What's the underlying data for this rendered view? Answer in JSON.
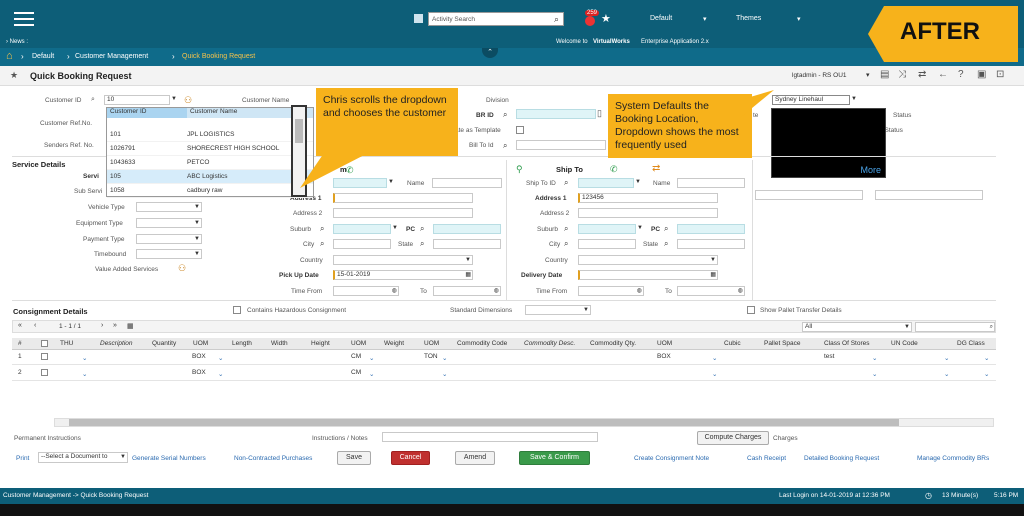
{
  "topbar": {
    "search_placeholder": "Activity Search",
    "notif_count": "259",
    "default_label": "Default",
    "themes_label": "Themes",
    "after_label": "AFTER"
  },
  "news": {
    "label": "› News :",
    "welcome": "Welcome to",
    "app_name": "VirtualWorks",
    "app_rest": "Enterprise Application 2.x"
  },
  "breadcrumb": {
    "items": [
      "Default",
      "Customer Management",
      "Quick Booking Request"
    ]
  },
  "page": {
    "title": "Quick Booking Request",
    "user": "lgtadmin - RS OU1"
  },
  "form": {
    "customer_id_label": "Customer ID",
    "customer_id_value": "10",
    "customer_name_label": "Customer Name",
    "customer_ref_label": "Customer Ref.No.",
    "senders_ref_label": "Senders Ref. No.",
    "division_label": "Division",
    "br_id_label": "BR ID",
    "as_template_label": "ate as Template",
    "bill_to_label": "Bill To Id",
    "booking_loc_value": "Sydney Linehaul",
    "booking_loc_label": "de",
    "status_label": "Status",
    "status2_label": "w Status",
    "more_label": "More",
    "t_label": "te"
  },
  "dropdown": {
    "col1": "Customer ID",
    "col2": "Customer Name",
    "rows": [
      {
        "id": "101",
        "name": "JPL LOGISTICS"
      },
      {
        "id": "1026791",
        "name": "SHORECREST HIGH SCHOOL"
      },
      {
        "id": "1043633",
        "name": "PETCO"
      },
      {
        "id": "105",
        "name": "ABC Logistics"
      },
      {
        "id": "1058",
        "name": "cadbury raw"
      }
    ]
  },
  "callouts": {
    "left": "Chris scrolls the dropdown and chooses the customer",
    "right": "System Defaults the Booking Location, Dropdown shows the most frequently used"
  },
  "service": {
    "title": "Service Details",
    "service_label": "Servi",
    "sub_label": "Sub Servi",
    "vehicle_label": "Vehicle Type",
    "equipment_label": "Equipment Type",
    "payment_label": "Payment Type",
    "timebound_label": "Timebound",
    "vas_label": "Value Added Services"
  },
  "shipfrom": {
    "title": "m",
    "name_label": "Name",
    "addr1_label": "Address 1",
    "addr2_label": "Address 2",
    "suburb_label": "Suburb",
    "pc_label": "PC",
    "city_label": "City",
    "state_label": "State",
    "country_label": "Country",
    "pickup_label": "Pick Up Date",
    "pickup_value": "15-01-2019",
    "timefrom_label": "Time From",
    "to_label": "To"
  },
  "shipto": {
    "title": "Ship To",
    "shipto_id_label": "Ship To ID",
    "name_label": "Name",
    "addr1_label": "Address 1",
    "addr1_value": "123456",
    "addr2_label": "Address 2",
    "suburb_label": "Suburb",
    "pc_label": "PC",
    "city_label": "City",
    "state_label": "State",
    "country_label": "Country",
    "delivery_label": "Delivery Date",
    "timefrom_label": "Time From",
    "to_label": "To"
  },
  "consignment": {
    "title": "Consignment Details",
    "hazard_label": "Contains Hazardous Consignment",
    "std_dim_label": "Standard Dimensions",
    "pallet_label": "Show Pallet Transfer Details",
    "pager": "1 - 1 / 1",
    "filter_value": "All"
  },
  "grid": {
    "columns": [
      "#",
      "THU",
      "Description",
      "Quantity",
      "UOM",
      "Length",
      "Width",
      "Height",
      "UOM",
      "Weight",
      "UOM",
      "Commodity Code",
      "Commodity Desc.",
      "Commodity Qty.",
      "UOM",
      "Cubic",
      "Pallet Space",
      "Class Of Stores",
      "UN Code",
      "DG Class"
    ],
    "rows": [
      {
        "n": "1",
        "uom1": "BOX",
        "uom2": "CM",
        "uom3": "TON",
        "uom4": "BOX",
        "stores": "test"
      },
      {
        "n": "2",
        "uom1": "BOX",
        "uom2": "CM",
        "uom3": "",
        "uom4": "",
        "stores": ""
      }
    ]
  },
  "footer": {
    "perm_label": "Permanent Instructions",
    "instr_label": "Instructions / Notes",
    "compute_label": "Compute Charges",
    "charges_label": "Charges",
    "print_label": "Print",
    "select_doc": "--Select a Document to",
    "gen_serial": "Generate Serial Numbers",
    "non_contracted": "Non-Contracted Purchases",
    "save": "Save",
    "cancel": "Cancel",
    "amend": "Amend",
    "save_confirm": "Save & Confirm",
    "create_note": "Create Consignment Note",
    "cash_receipt": "Cash Receipt",
    "detailed": "Detailed Booking Request",
    "manage_brs": "Manage Commodity BRs"
  },
  "status": {
    "path": "Customer Management -> Quick Booking Request",
    "last_login": "Last Login on 14-01-2019 at 12:36 PM",
    "minutes": "13 Minute(s)",
    "time": "5:16 PM"
  },
  "colors": {
    "header": "#0d5e78",
    "callout": "#f7b21b",
    "save_confirm": "#3a9a4a",
    "cancel": "#c0302f"
  }
}
